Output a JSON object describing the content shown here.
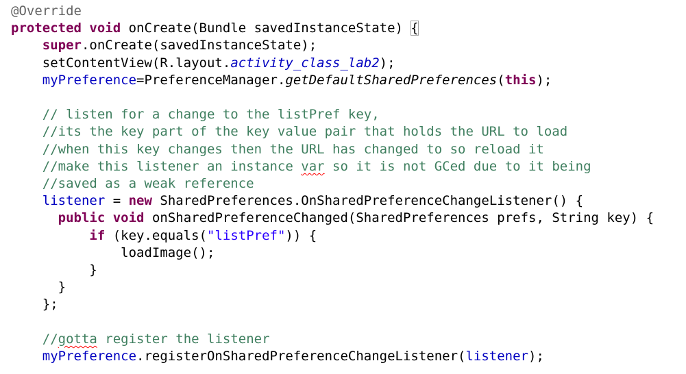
{
  "editor": {
    "lines": [
      {
        "indent": "",
        "tokens": [
          {
            "type": "annotation",
            "text": "@Override"
          }
        ]
      },
      {
        "indent": "",
        "tokens": [
          {
            "type": "keyword",
            "text": "protected"
          },
          {
            "type": "plain",
            "text": " "
          },
          {
            "type": "keyword",
            "text": "void"
          },
          {
            "type": "plain",
            "text": " onCreate(Bundle savedInstanceState) "
          },
          {
            "type": "bracket-box",
            "text": "{"
          }
        ]
      },
      {
        "indent": "    ",
        "tokens": [
          {
            "type": "keyword",
            "text": "super"
          },
          {
            "type": "plain",
            "text": ".onCreate(savedInstanceState);"
          }
        ]
      },
      {
        "indent": "    ",
        "tokens": [
          {
            "type": "plain",
            "text": "setContentView(R.layout."
          },
          {
            "type": "field-italic",
            "text": "activity_class_lab2"
          },
          {
            "type": "plain",
            "text": ");"
          }
        ]
      },
      {
        "indent": "    ",
        "tokens": [
          {
            "type": "field",
            "text": "myPreference"
          },
          {
            "type": "plain",
            "text": "=PreferenceManager."
          },
          {
            "type": "static-italic",
            "text": "getDefaultSharedPreferences"
          },
          {
            "type": "plain",
            "text": "("
          },
          {
            "type": "keyword",
            "text": "this"
          },
          {
            "type": "plain",
            "text": ");"
          }
        ]
      },
      {
        "indent": "",
        "tokens": []
      },
      {
        "indent": "    ",
        "tokens": [
          {
            "type": "comment",
            "text": "// listen for a change to the listPref key,"
          }
        ]
      },
      {
        "indent": "    ",
        "tokens": [
          {
            "type": "comment",
            "text": "//its the key part of the key value pair that holds the URL to load"
          }
        ]
      },
      {
        "indent": "    ",
        "tokens": [
          {
            "type": "comment",
            "text": "//when this key changes then the URL has changed to so reload it"
          }
        ]
      },
      {
        "indent": "    ",
        "tokens": [
          {
            "type": "comment",
            "text": "//make this listener an instance "
          },
          {
            "type": "comment-squiggle",
            "text": "var"
          },
          {
            "type": "comment",
            "text": " so it is not GCed due to it being"
          }
        ]
      },
      {
        "indent": "    ",
        "tokens": [
          {
            "type": "comment",
            "text": "//saved as a weak reference"
          }
        ]
      },
      {
        "indent": "    ",
        "tokens": [
          {
            "type": "field",
            "text": "listener"
          },
          {
            "type": "plain",
            "text": " = "
          },
          {
            "type": "keyword",
            "text": "new"
          },
          {
            "type": "plain",
            "text": " SharedPreferences.OnSharedPreferenceChangeListener() {"
          }
        ]
      },
      {
        "indent": "      ",
        "tokens": [
          {
            "type": "keyword",
            "text": "public"
          },
          {
            "type": "plain",
            "text": " "
          },
          {
            "type": "keyword",
            "text": "void"
          },
          {
            "type": "plain",
            "text": " onSharedPreferenceChanged(SharedPreferences prefs, String key) {"
          }
        ]
      },
      {
        "indent": "          ",
        "tokens": [
          {
            "type": "keyword",
            "text": "if"
          },
          {
            "type": "plain",
            "text": " (key.equals("
          },
          {
            "type": "string",
            "text": "\"listPref\""
          },
          {
            "type": "plain",
            "text": ")) {"
          }
        ]
      },
      {
        "indent": "              ",
        "tokens": [
          {
            "type": "plain",
            "text": "loadImage();"
          }
        ]
      },
      {
        "indent": "          ",
        "tokens": [
          {
            "type": "plain",
            "text": "}"
          }
        ]
      },
      {
        "indent": "      ",
        "tokens": [
          {
            "type": "plain",
            "text": "}"
          }
        ]
      },
      {
        "indent": "    ",
        "tokens": [
          {
            "type": "plain",
            "text": "};"
          }
        ]
      },
      {
        "indent": "",
        "tokens": []
      },
      {
        "indent": "    ",
        "tokens": [
          {
            "type": "comment",
            "text": "//"
          },
          {
            "type": "comment-squiggle",
            "text": "gotta"
          },
          {
            "type": "comment",
            "text": " register the listener"
          }
        ]
      },
      {
        "indent": "    ",
        "tokens": [
          {
            "type": "field",
            "text": "myPreference"
          },
          {
            "type": "plain",
            "text": ".registerOnSharedPreferenceChangeListener("
          },
          {
            "type": "field",
            "text": "listener"
          },
          {
            "type": "plain",
            "text": ");"
          }
        ]
      }
    ]
  },
  "colors": {
    "background": "#ffffff",
    "keyword": "#7f0055",
    "annotation": "#646464",
    "comment": "#3f7f5f",
    "field": "#0000c0",
    "string": "#2a00ff",
    "plain": "#000000",
    "squiggle": "#ff0000"
  }
}
